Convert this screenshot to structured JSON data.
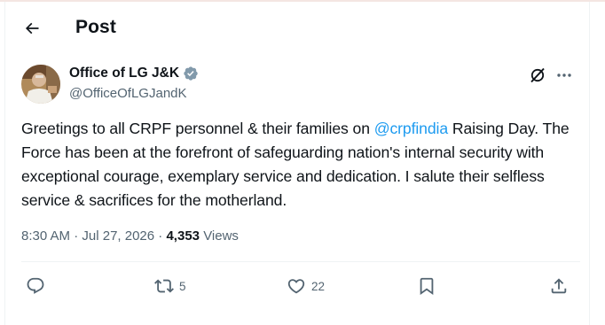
{
  "header": {
    "title": "Post"
  },
  "author": {
    "name": "Office of LG J&K",
    "handle": "@OfficeOfLGJandK",
    "verified_color": "#829aab"
  },
  "tweet": {
    "text_before": "Greetings to all CRPF personnel & their families on ",
    "mention": "@crpfindia",
    "text_after": " Raising Day. The Force has been at the forefront of safeguarding nation's internal security with exceptional courage, exemplary service and dedication. I salute their selfless service & sacrifices for the motherland."
  },
  "meta": {
    "time": "8:30 AM",
    "separator": " · ",
    "date": "Jul 27, 2026",
    "views_count": "4,353",
    "views_label": "Views"
  },
  "actions": {
    "reply_count": "",
    "repost_count": "5",
    "like_count": "22"
  },
  "icons": {
    "back": "arrow-left-icon",
    "verified": "verified-badge-icon",
    "grok": "grok-icon",
    "more": "more-dots-icon",
    "reply": "reply-icon",
    "repost": "repost-icon",
    "like": "heart-icon",
    "bookmark": "bookmark-icon",
    "share": "share-icon"
  },
  "colors": {
    "text": "#0f1419",
    "secondary": "#536471",
    "accent": "#1d9bf0",
    "divider": "#eff3f4"
  }
}
